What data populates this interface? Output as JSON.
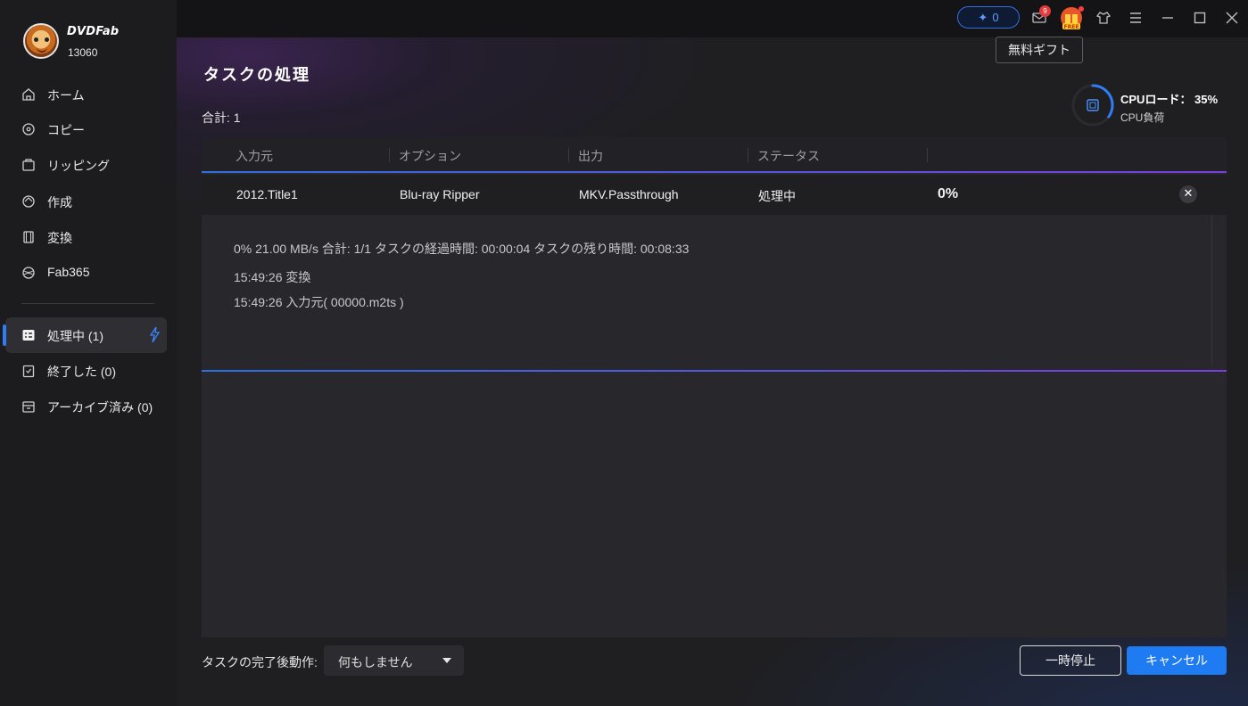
{
  "app": {
    "brand": "DVDFab",
    "version": "13060"
  },
  "sidebar": {
    "items": [
      {
        "label": "ホーム",
        "icon": "home-icon"
      },
      {
        "label": "コピー",
        "icon": "copy-icon"
      },
      {
        "label": "リッピング",
        "icon": "ripper-icon"
      },
      {
        "label": "作成",
        "icon": "creator-icon"
      },
      {
        "label": "変換",
        "icon": "converter-icon"
      },
      {
        "label": "Fab365",
        "icon": "fab365-icon"
      }
    ],
    "queue": [
      {
        "label": "処理中 (1)",
        "icon": "task-list-icon",
        "active": true
      },
      {
        "label": "終了した (0)",
        "icon": "finished-icon"
      },
      {
        "label": "アーカイブ済み (0)",
        "icon": "archive-icon"
      }
    ]
  },
  "titlebar": {
    "credits": "0",
    "mail_badge": "9",
    "gift_tooltip": "無料ギフト",
    "gift_tag": "FREE"
  },
  "main": {
    "title": "タスクの処理",
    "total": "合計: 1",
    "cpu": {
      "title": "CPUロード：  35%",
      "subtitle": "CPU負荷",
      "load": 0.35
    },
    "table": {
      "headers": [
        "入力元",
        "オプション",
        "出力",
        "ステータス"
      ],
      "row": {
        "source": "2012.Title1",
        "option": "Blu-ray Ripper",
        "output": "MKV.Passthrough",
        "status": "処理中",
        "progress": "0%"
      },
      "detail": {
        "summary": "0%  21.00 MB/s   合計: 1/1  タスクの経過時間: 00:00:04  タスクの残り時間: 00:08:33",
        "logs": [
          "15:49:26  変換",
          "15:49:26  入力元( 00000.m2ts )"
        ]
      }
    },
    "after_label": "タスクの完了後動作:",
    "after_value": "何もしません",
    "pause": "一時停止",
    "cancel": "キャンセル"
  },
  "colors": {
    "accent": "#1f7bf2",
    "ring": "#2f7cf6",
    "badge": "#e23b3b"
  }
}
